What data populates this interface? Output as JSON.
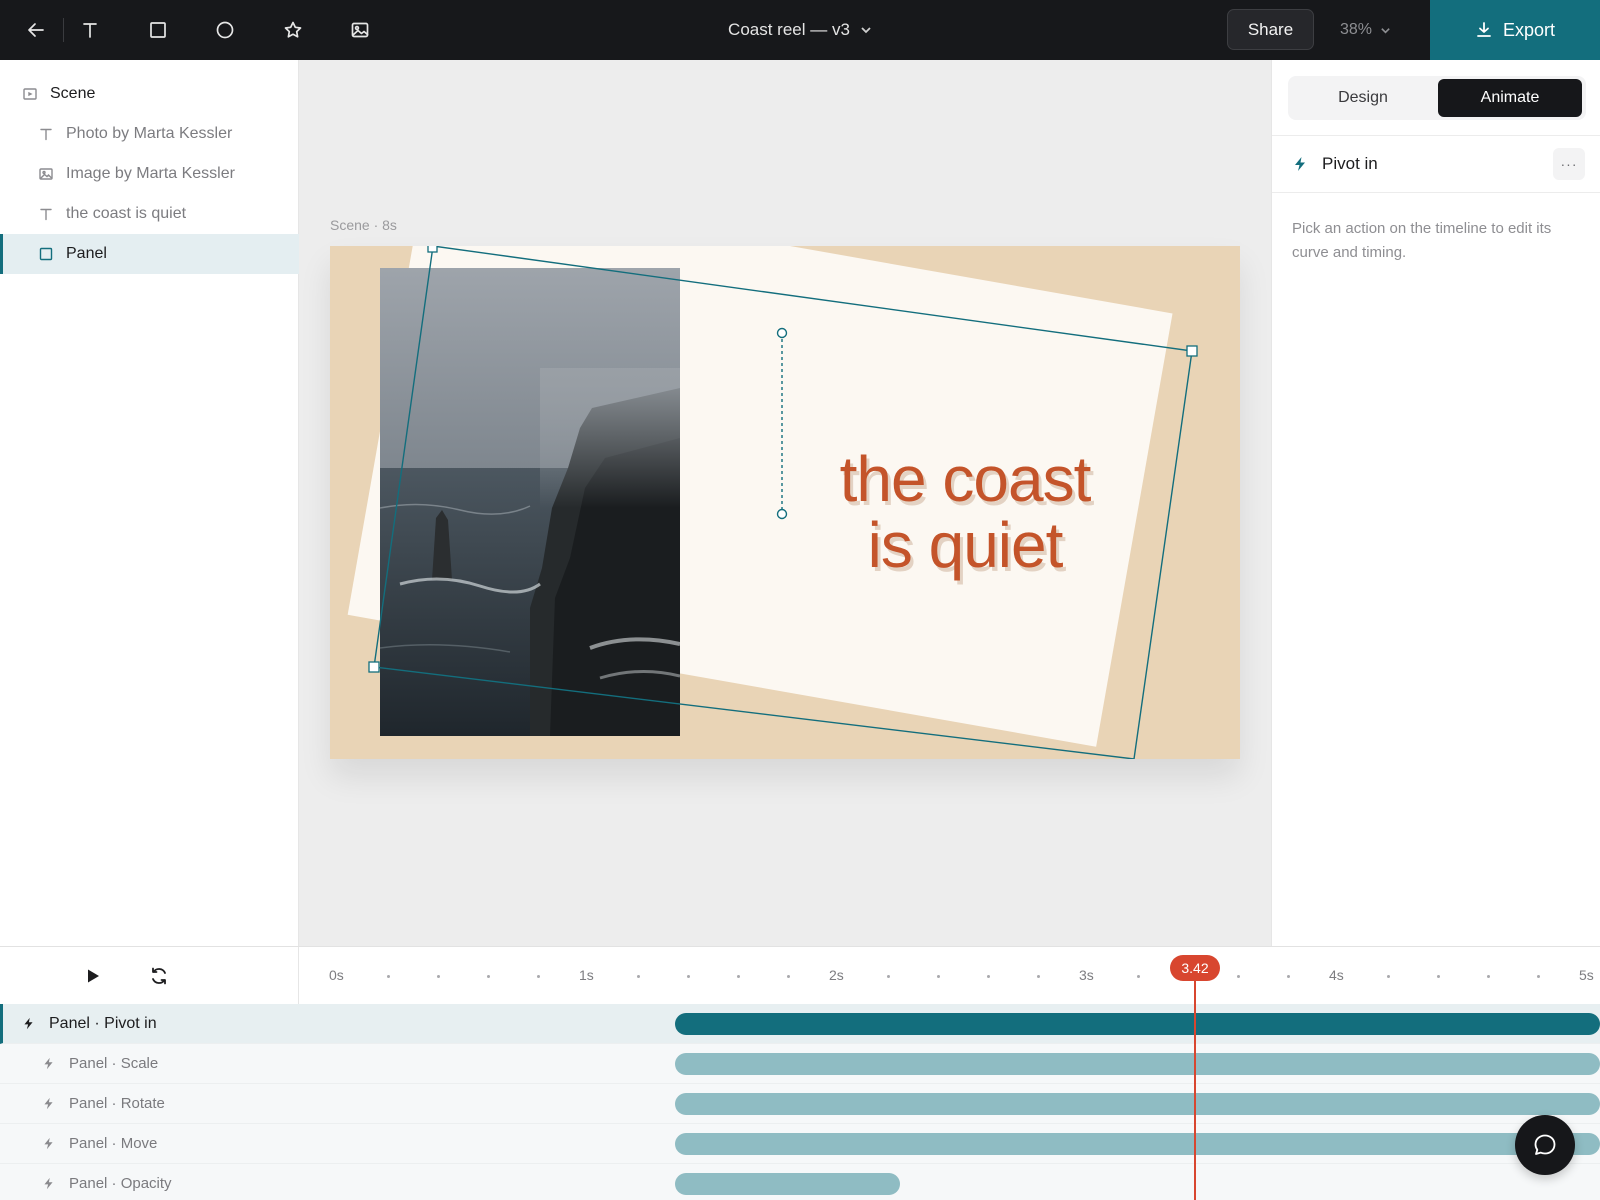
{
  "toolbar": {
    "tools": [
      {
        "name": "back",
        "icon": "back-arrow-icon"
      },
      {
        "name": "text",
        "icon": "text-tool-icon"
      },
      {
        "name": "rectangle",
        "icon": "rectangle-tool-icon"
      },
      {
        "name": "ellipse",
        "icon": "ellipse-tool-icon"
      },
      {
        "name": "star",
        "icon": "star-tool-icon"
      },
      {
        "name": "image",
        "icon": "image-tool-icon"
      }
    ],
    "document_title": "Coast reel — v3",
    "share_label": "Share",
    "zoom_label": "38%",
    "export_label": "Export"
  },
  "layers": {
    "root": {
      "label": "Scene",
      "icon": "frame-icon"
    },
    "items": [
      {
        "label": "Photo by Marta Kessler",
        "icon": "text-icon",
        "selected": false
      },
      {
        "label": "Image by Marta Kessler",
        "icon": "image-icon",
        "selected": false
      },
      {
        "label": "the coast is quiet",
        "icon": "text-icon",
        "selected": false
      },
      {
        "label": "Panel",
        "icon": "rectangle-icon",
        "selected": true
      }
    ]
  },
  "canvas": {
    "scene_label": "Scene · 8s",
    "headline_line1": "the coast",
    "headline_line2": "is quiet",
    "colors": {
      "background": "#e9d4b6",
      "panel": "#fcf8f2",
      "headline": "#c4542a",
      "selection": "#136e7d"
    }
  },
  "inspector": {
    "tabs": [
      {
        "label": "Design",
        "active": false
      },
      {
        "label": "Animate",
        "active": true
      }
    ],
    "action_title": "Pivot in",
    "more_label": "···",
    "hint": "Pick an action on the timeline to edit its curve and timing."
  },
  "timeline": {
    "ticks": [
      "0s",
      "1s",
      "2s",
      "3s",
      "4s",
      "5s"
    ],
    "playhead_label": "3.42",
    "playhead_seconds": 3.42,
    "tracks": [
      {
        "label": "Panel · Pivot in",
        "parent": true,
        "start_s": 1.3,
        "end_s": 5.2
      },
      {
        "label": "Panel · Scale",
        "parent": false,
        "start_s": 1.3,
        "end_s": 5.2
      },
      {
        "label": "Panel · Rotate",
        "parent": false,
        "start_s": 1.3,
        "end_s": 5.2
      },
      {
        "label": "Panel · Move",
        "parent": false,
        "start_s": 1.3,
        "end_s": 5.2
      },
      {
        "label": "Panel · Opacity",
        "parent": false,
        "start_s": 1.3,
        "end_s": 2.25
      }
    ],
    "colors": {
      "main_bar": "#136e7d",
      "sub_bar": "#8fbcc3",
      "playhead": "#d8462f"
    }
  }
}
